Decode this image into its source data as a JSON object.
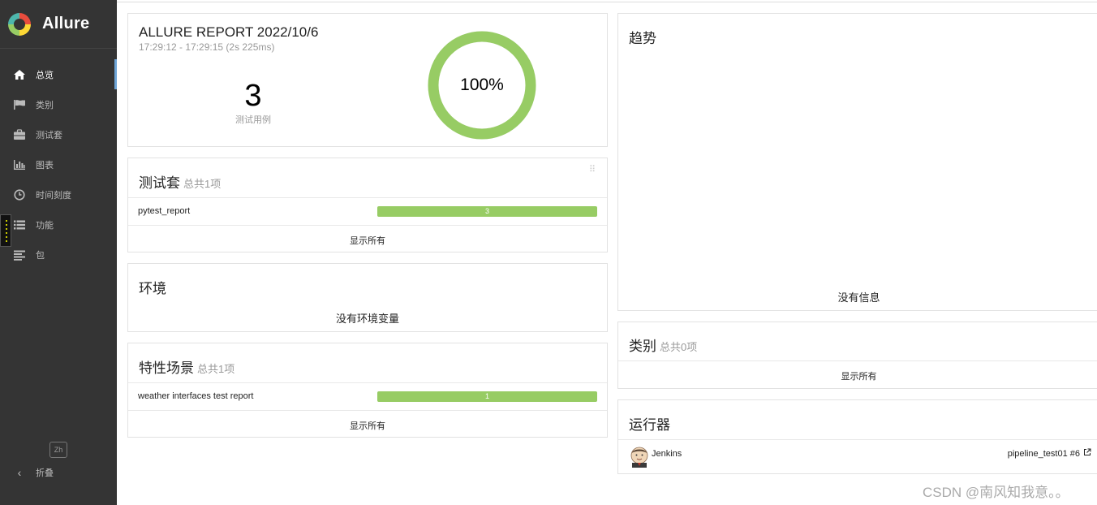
{
  "app": {
    "name": "Allure"
  },
  "sidebar": {
    "items": [
      {
        "label": "总览",
        "icon": "home-icon",
        "active": true
      },
      {
        "label": "类别",
        "icon": "flag-icon",
        "active": false
      },
      {
        "label": "测试套",
        "icon": "briefcase-icon",
        "active": false
      },
      {
        "label": "图表",
        "icon": "bar-chart-icon",
        "active": false
      },
      {
        "label": "时间刻度",
        "icon": "clock-icon",
        "active": false
      },
      {
        "label": "功能",
        "icon": "list-icon",
        "active": false
      },
      {
        "label": "包",
        "icon": "align-left-icon",
        "active": false
      }
    ],
    "language": "Zh",
    "collapse_label": "折叠"
  },
  "summary": {
    "title": "ALLURE REPORT 2022/10/6",
    "time_range": "17:29:12 - 17:29:15 (2s 225ms)",
    "test_count": "3",
    "test_count_label": "测试用例",
    "pass_percent": "100%",
    "pass_fraction": 1.0,
    "color_passed": "#97cc64"
  },
  "suites": {
    "title": "测试套",
    "subtitle": "总共1项",
    "rows": [
      {
        "name": "pytest_report",
        "passed": "3"
      }
    ],
    "show_all": "显示所有"
  },
  "environment": {
    "title": "环境",
    "empty_text": "没有环境变量"
  },
  "features": {
    "title": "特性场景",
    "subtitle": "总共1项",
    "rows": [
      {
        "name": "weather interfaces test report",
        "passed": "1"
      }
    ],
    "show_all": "显示所有"
  },
  "trend": {
    "title": "趋势",
    "empty_text": "没有信息"
  },
  "categories": {
    "title": "类别",
    "subtitle": "总共0项",
    "show_all": "显示所有"
  },
  "executors": {
    "title": "运行器",
    "items": [
      {
        "name": "Jenkins",
        "build": "pipeline_test01 #6"
      }
    ]
  },
  "watermark": "CSDN @南风知我意。。"
}
